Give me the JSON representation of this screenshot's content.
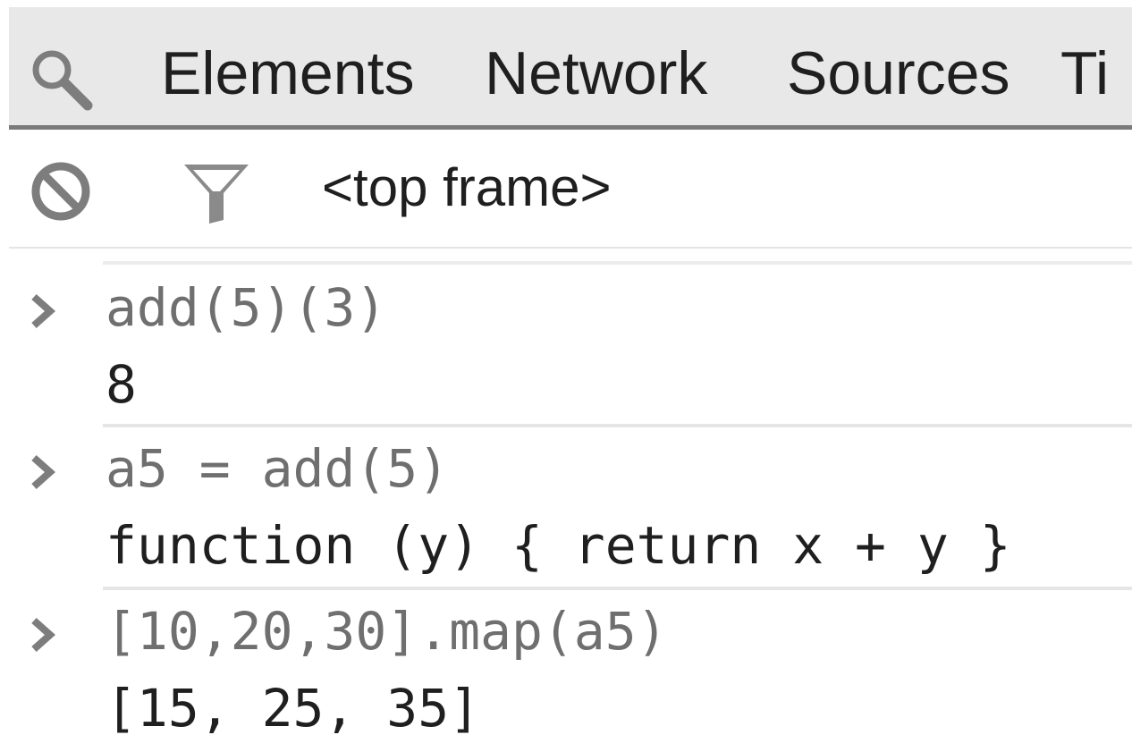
{
  "tabs": {
    "items": [
      {
        "label": "Elements"
      },
      {
        "label": "Network"
      },
      {
        "label": "Sources"
      },
      {
        "label": "Ti"
      }
    ],
    "search_icon": "search-icon"
  },
  "toolbar": {
    "clear_icon": "clear-console-icon",
    "filter_icon": "filter-icon",
    "frame_label": "<top frame>"
  },
  "console": {
    "entries": [
      {
        "input": "add(5)(3)",
        "output": "8"
      },
      {
        "input": "a5 = add(5)",
        "output": "function (y) { return x + y }"
      },
      {
        "input": "[10,20,30].map(a5)",
        "output": "[15, 25, 35]"
      }
    ],
    "prompt_icon": "prompt-chevron-icon"
  },
  "colors": {
    "tabbar_bg": "#e8e8e8",
    "tabbar_border": "#7a7a7a",
    "text_primary": "#1f1f1f",
    "input_text": "#6f6f6f",
    "icon_gray": "#7d7d7d"
  }
}
